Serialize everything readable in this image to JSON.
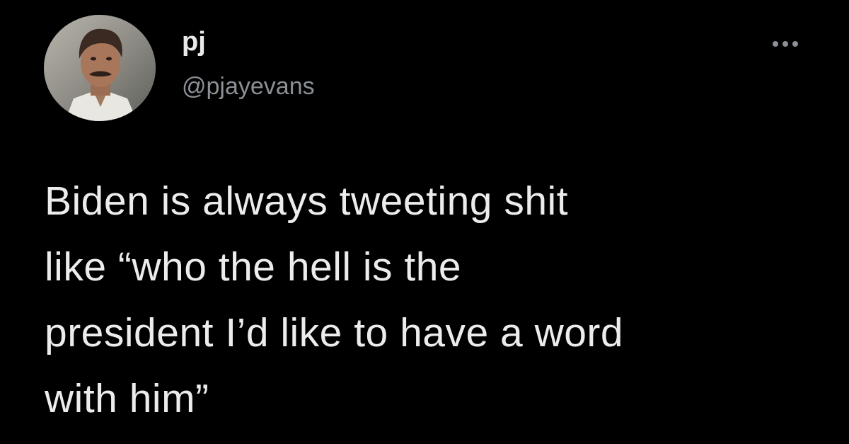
{
  "author": {
    "display_name": "pj",
    "handle": "@pjayevans"
  },
  "menu": {
    "icon": "more-horizontal-icon"
  },
  "tweet": {
    "text": "Biden is always tweeting shit\nlike “who the hell is the\npresident I’d like to have a word\nwith him”"
  },
  "colors": {
    "background": "#000000",
    "primary_text": "#e7e9ea",
    "secondary_text": "#8b9096"
  }
}
